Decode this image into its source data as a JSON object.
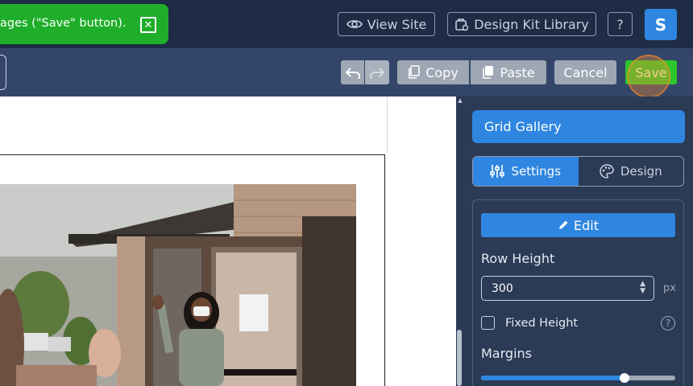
{
  "toast": {
    "message": "ages (\"Save\" button)."
  },
  "header": {
    "view_site": "View Site",
    "design_kit": "Design Kit Library",
    "help": "?",
    "avatar": "S"
  },
  "toolbar": {
    "copy": "Copy",
    "paste": "Paste",
    "cancel": "Cancel",
    "save": "Save"
  },
  "panel": {
    "title": "Grid Gallery",
    "tabs": [
      {
        "label": "Settings",
        "active": true
      },
      {
        "label": "Design",
        "active": false
      }
    ],
    "edit_label": "Edit",
    "row_height_label": "Row Height",
    "row_height_value": "300",
    "row_height_unit": "px",
    "fixed_height_label": "Fixed Height",
    "fixed_height_checked": false,
    "margins_label": "Margins",
    "margins_slider_fraction": 0.74
  },
  "colors": {
    "accent": "#2f86e0",
    "save": "#2ec52d",
    "toast": "#1fae2a"
  }
}
